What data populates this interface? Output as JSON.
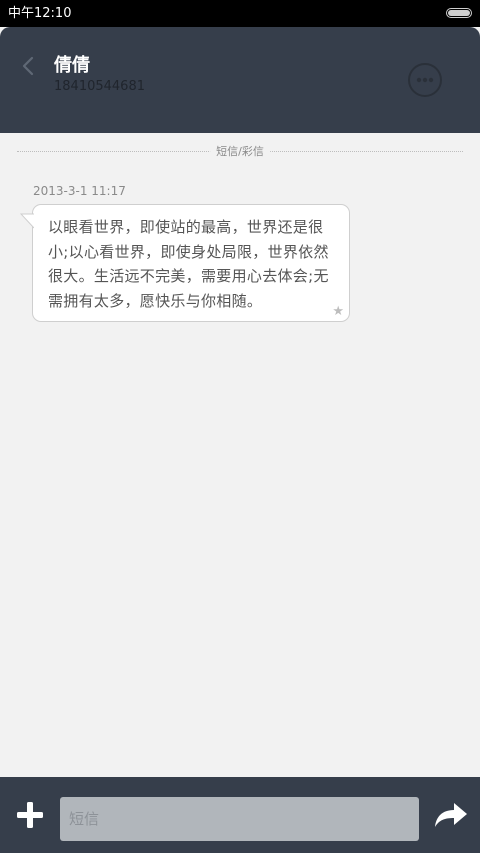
{
  "status_bar": {
    "time": "中午12:10",
    "battery_icon": "battery-icon"
  },
  "header": {
    "back_icon": "chevron-left-icon",
    "contact_name": "倩倩",
    "contact_number": "18410544681",
    "more_icon": "more-dots-icon"
  },
  "thread": {
    "divider_label": "短信/彩信",
    "messages": [
      {
        "timestamp": "2013-3-1 11:17",
        "text": "以眼看世界，即使站的最高，世界还是很小;以心看世界，即使身处局限，世界依然很大。生活远不完美，需要用心去体会;无需拥有太多，愿快乐与你相随。",
        "starred_icon": "star-icon"
      }
    ]
  },
  "composer": {
    "add_icon": "plus-icon",
    "placeholder": "短信",
    "value": "",
    "send_icon": "send-arrow-icon"
  },
  "colors": {
    "header_bg": "#363e4b",
    "page_bg": "#f2f2f2",
    "input_bg": "#b1b6bb",
    "bubble_bg": "#ffffff"
  }
}
